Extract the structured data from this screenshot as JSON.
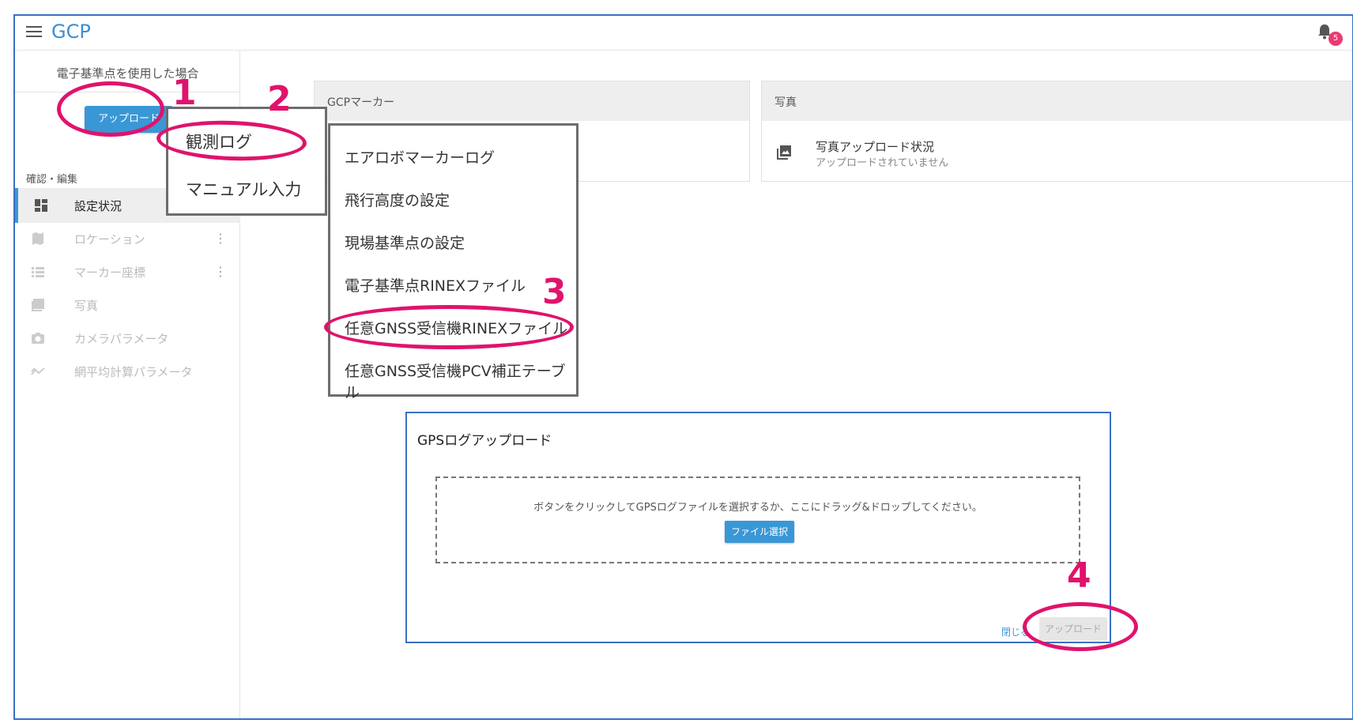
{
  "header": {
    "menu_icon": "hamburger-icon",
    "title": "GCP",
    "bell_icon": "bell-icon",
    "notification_count": "5"
  },
  "sidebar": {
    "title": "電子基準点を使用した場合",
    "upload_label": "アップロード",
    "section_label": "確認・編集",
    "items": [
      {
        "label": "設定状況",
        "icon": "dashboard-icon",
        "active": true
      },
      {
        "label": "ロケーション",
        "icon": "map-icon",
        "kebab": "⋮"
      },
      {
        "label": "マーカー座標",
        "icon": "list-icon",
        "kebab": "⋮"
      },
      {
        "label": "写真",
        "icon": "photo-icon"
      },
      {
        "label": "カメラパラメータ",
        "icon": "camera-icon"
      },
      {
        "label": "網平均計算パラメータ",
        "icon": "trending-icon"
      }
    ]
  },
  "cards": {
    "gcp": {
      "title": "GCPマーカー"
    },
    "photo": {
      "title": "写真",
      "row_title": "写真アップロード状況",
      "row_sub": "アップロードされていません",
      "row_icon": "photo-library-icon"
    }
  },
  "menu_upload": {
    "items": [
      "観測ログ",
      "マニュアル入力"
    ]
  },
  "menu_log": {
    "items": [
      "エアロボマーカーログ",
      "飛行高度の設定",
      "現場基準点の設定",
      "電子基準点RINEXファイル",
      "任意GNSS受信機RINEXファイル",
      "任意GNSS受信機PCV補正テーブル"
    ]
  },
  "dialog": {
    "title": "GPSログアップロード",
    "drop_text": "ボタンをクリックしてGPSログファイルを選択するか、ここにドラッグ&ドロップしてください。",
    "file_select_label": "ファイル選択",
    "close_label": "閉じる",
    "upload_label": "アップロード"
  },
  "annotations": {
    "step1": "1",
    "step2": "2",
    "step3": "3",
    "step4": "4",
    "color": "#e0136c"
  }
}
